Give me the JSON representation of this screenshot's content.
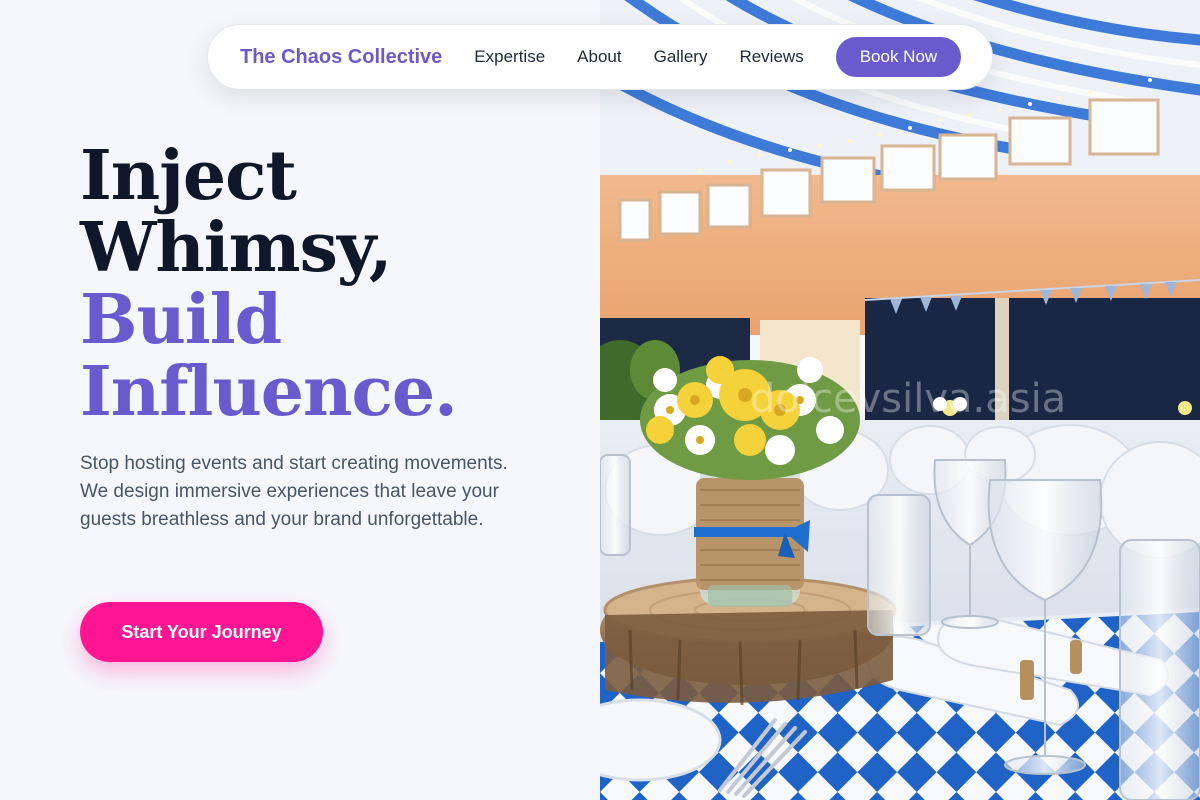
{
  "nav": {
    "brand": "The Chaos Collective",
    "links": [
      "Expertise",
      "About",
      "Gallery",
      "Reviews"
    ],
    "cta": "Book Now"
  },
  "hero": {
    "headline_dark": [
      "Inject",
      "Whimsy,"
    ],
    "headline_accent": [
      "Build",
      "Influence."
    ],
    "lead": "Stop hosting events and start creating movements. We design immersive experiences that leave your guests breathless and your brand unforgettable.",
    "cta": "Start Your Journey",
    "image_watermark": "dolcevsilva.asia"
  },
  "colors": {
    "accent": "#6a5acd",
    "cta_pink": "#ff1493",
    "heading_dark": "#0f172a",
    "body_text": "#475569",
    "page_bg": "#f6f7fc"
  }
}
